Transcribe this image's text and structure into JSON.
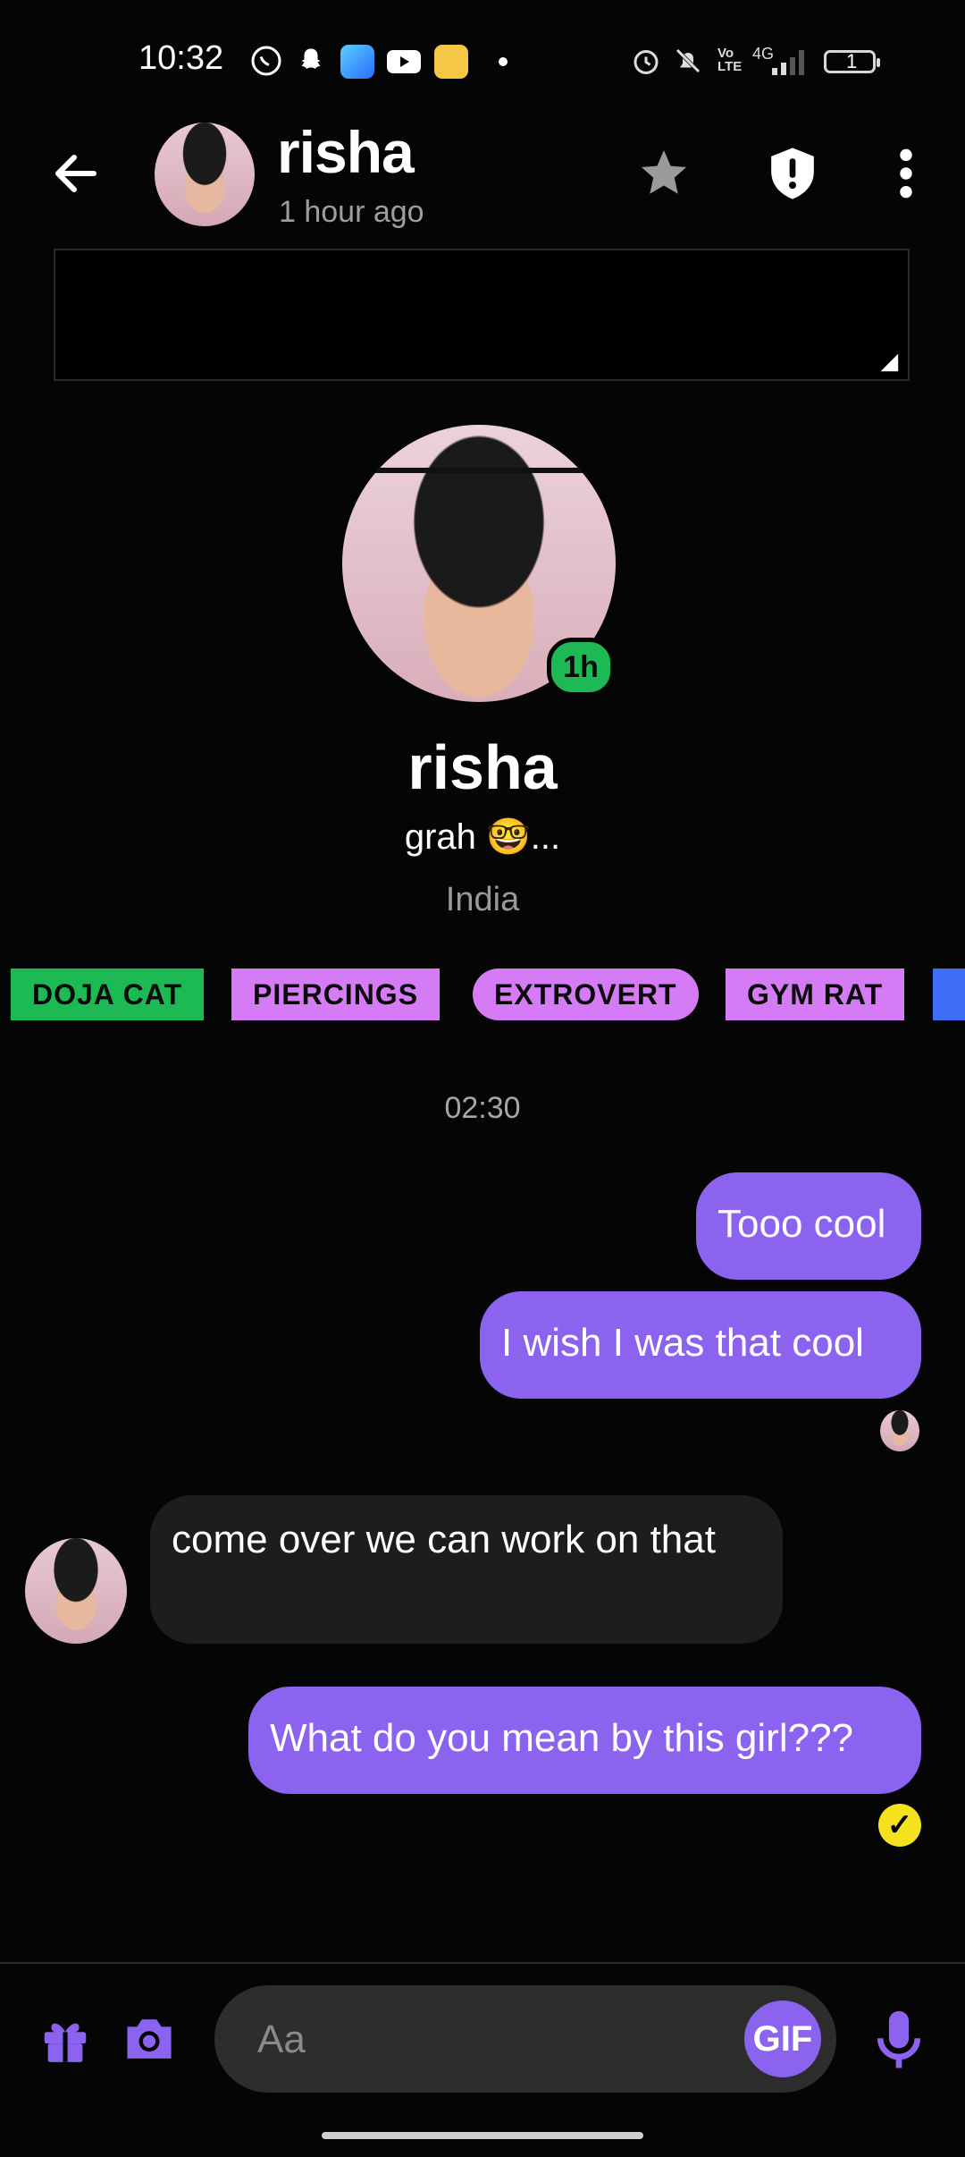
{
  "status_bar": {
    "time": "10:32",
    "battery": "1",
    "network": "4G"
  },
  "header": {
    "name": "risha",
    "last_seen": "1 hour ago",
    "icons": [
      "back-arrow-icon",
      "star-icon",
      "shield-icon",
      "more-vertical-icon"
    ]
  },
  "profile": {
    "name": "risha",
    "bio": "grah 🤓...",
    "location": "India",
    "story_badge": "1h",
    "tags": [
      "DOJA CAT",
      "PIERCINGS",
      "EXTROVERT",
      "GYM RAT"
    ]
  },
  "chat": {
    "timestamp": "02:30",
    "messages": [
      {
        "from": "me",
        "text": "Tooo cool"
      },
      {
        "from": "me",
        "text": "I wish I was that cool"
      },
      {
        "from": "them",
        "text": "come over we can work on that"
      },
      {
        "from": "me",
        "text": "What do you mean by this girl???"
      }
    ]
  },
  "composer": {
    "placeholder": "Aa",
    "gif_label": "GIF",
    "icons": [
      "gift-icon",
      "camera-icon",
      "microphone-icon"
    ]
  },
  "colors": {
    "accent": "#8b63ef",
    "tag_green": "#1db954",
    "tag_purple": "#d57bf5",
    "read_check": "#f5e11d"
  }
}
